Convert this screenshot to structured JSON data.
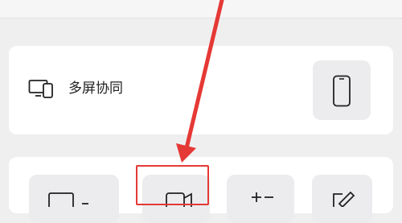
{
  "multi_screen": {
    "label": "多屏协同",
    "icon": "multi-device-icon",
    "action_icon": "phone-icon"
  },
  "tools": [
    {
      "icon": "screen-share-icon"
    },
    {
      "icon": "video-camera-icon"
    },
    {
      "icon": "calculator-icon"
    },
    {
      "icon": "edit-note-icon"
    }
  ],
  "annotation": {
    "color": "#e53935",
    "arrow_icon": "pointer-arrow-icon"
  }
}
